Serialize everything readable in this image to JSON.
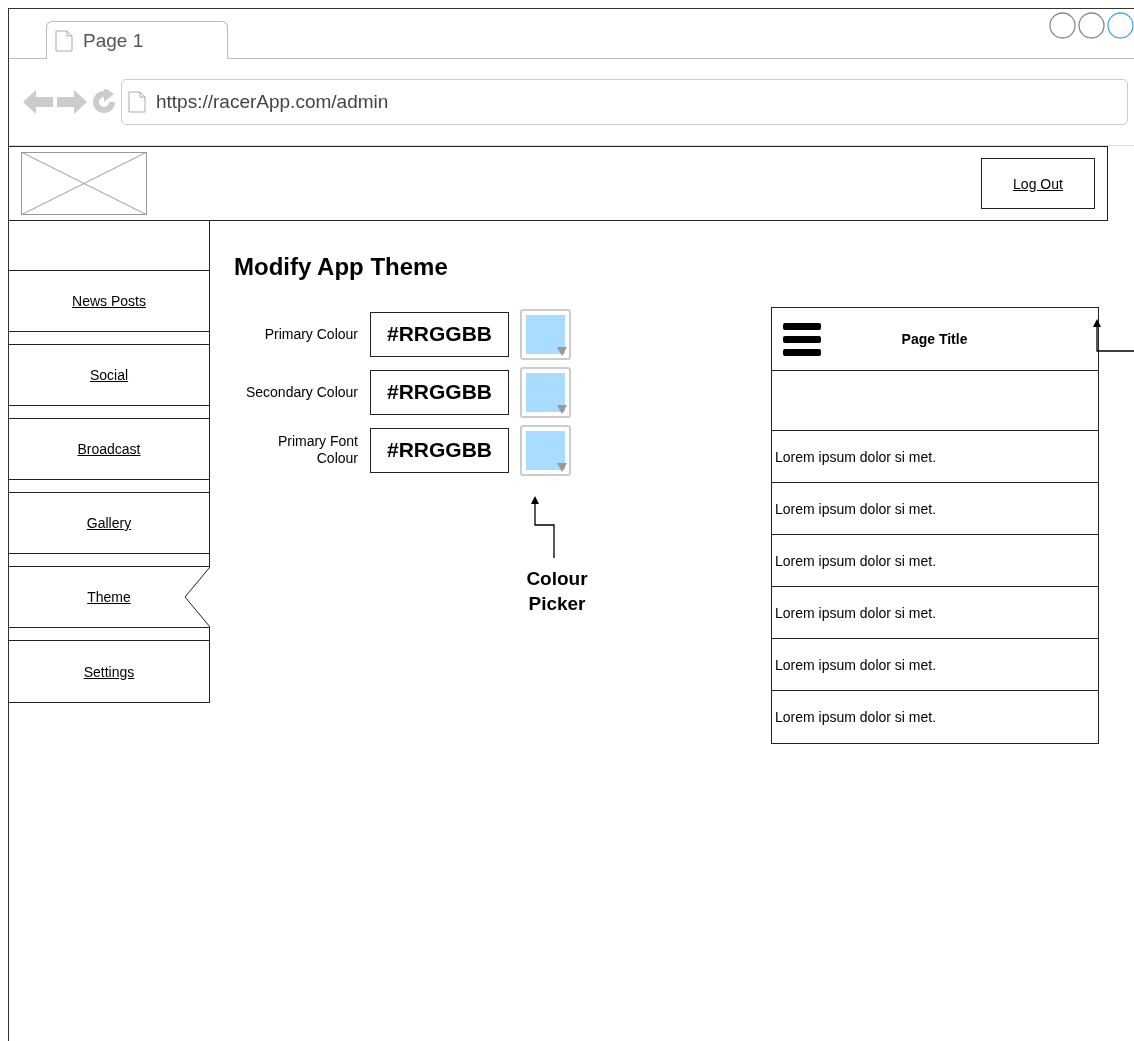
{
  "browser": {
    "tab_title": "Page 1",
    "url": "https://racerApp.com/admin"
  },
  "header": {
    "logout": "Log Out"
  },
  "sidebar": {
    "items": [
      {
        "label": "News Posts",
        "selected": false
      },
      {
        "label": "Social",
        "selected": false
      },
      {
        "label": "Broadcast",
        "selected": false
      },
      {
        "label": "Gallery",
        "selected": false
      },
      {
        "label": "Theme",
        "selected": true
      },
      {
        "label": "Settings",
        "selected": false
      }
    ]
  },
  "form": {
    "title": "Modify App Theme",
    "fields": [
      {
        "label": "Primary Colour",
        "value": "#RRGGBB"
      },
      {
        "label": "Secondary Colour",
        "value": "#RRGGBB"
      },
      {
        "label": "Primary Font Colour",
        "value": "#RRGGBB"
      }
    ]
  },
  "annotation": "Colour Picker",
  "phone": {
    "title": "Page Title",
    "rows": [
      "Lorem ipsum dolor si met.",
      "Lorem ipsum dolor si met.",
      "Lorem ipsum dolor si met.",
      "Lorem ipsum dolor si met.",
      "Lorem ipsum dolor si met.",
      "Lorem ipsum dolor si met."
    ]
  }
}
